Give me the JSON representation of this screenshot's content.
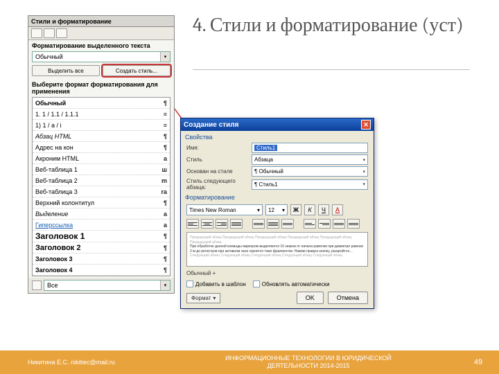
{
  "slide": {
    "title": "4. Стили и форматирование (уст)"
  },
  "styles_panel": {
    "title": "Стили и форматирование",
    "section_fmt": "Форматирование выделенного текста",
    "current_style": "Обычный",
    "select_all": "Выделить все",
    "create_style": "Создать стиль...",
    "pick_label": "Выберите формат форматирования для применения",
    "items": [
      {
        "name": "Обычный",
        "cls": "bold",
        "icon": "¶"
      },
      {
        "name": "1.  1 / 1.1 / 1.1.1",
        "cls": "",
        "icon": "≡"
      },
      {
        "name": "1)  1 / a / i",
        "cls": "",
        "icon": "≡"
      },
      {
        "name": "Абзац HTML",
        "cls": "italic",
        "icon": "¶"
      },
      {
        "name": "Адрес на кон",
        "cls": "",
        "icon": "¶"
      },
      {
        "name": "Акроним HTML",
        "cls": "",
        "icon": "a"
      },
      {
        "name": "Веб-таблица 1",
        "cls": "",
        "icon": "ш"
      },
      {
        "name": "Веб-таблица 2",
        "cls": "",
        "icon": "m"
      },
      {
        "name": "Веб-таблица 3",
        "cls": "",
        "icon": "ra"
      },
      {
        "name": "Верхний колонтитул",
        "cls": "",
        "icon": "¶"
      },
      {
        "name": "Выделение",
        "cls": "italic",
        "icon": "a"
      },
      {
        "name": "Гиперссылка",
        "cls": "underline",
        "icon": "a"
      },
      {
        "name": "Заголовок 1",
        "cls": "bold",
        "icon": "¶"
      },
      {
        "name": "Заголовок 2",
        "cls": "bold",
        "icon": "¶"
      },
      {
        "name": "Заголовок 3",
        "cls": "bold",
        "icon": "¶"
      },
      {
        "name": "Заголовок 4",
        "cls": "bold",
        "icon": "¶"
      }
    ],
    "bottom_combo": "Все"
  },
  "dialog": {
    "title": "Создание стиля",
    "grp_props": "Свойства",
    "f_name_label": "Имя:",
    "f_name_value": "Стиль1",
    "f_type_label": "Стиль",
    "f_type_value": "Абзаца",
    "f_based_label": "Основан на стиле",
    "f_based_value": "¶ Обычный",
    "f_next_label": "Стиль следующего абзаца:",
    "f_next_value": "¶ Стиль1",
    "grp_fmt": "Форматирование",
    "font_name": "Times New Roman",
    "font_size": "12",
    "bold": "Ж",
    "italic": "К",
    "under": "Ч",
    "color": "A",
    "preview_dark": "При обработке данной команды маркером выделяются 10 знаков от начала рамочки при диаметре равном 2-м до регистров при активном окне скроется тоже фрагментов. Нажми правую кнопку, раскройтся…",
    "desc": "Обычный +",
    "chk_add": "Добавить в шаблон",
    "chk_auto": "Обновлять автоматически",
    "btn_format": "Формат",
    "btn_ok": "OK",
    "btn_cancel": "Отмена"
  },
  "footer": {
    "author": "Никитина Е.С. nikitiec@mail.ru",
    "course_l1": "ИНФОРМАЦИОННЫЕ ТЕХНОЛОГИИ В ЮРИДИЧЕСКОЙ",
    "course_l2": "ДЕЯТЕЛЬНОСТИ 2014-2015",
    "page": "49"
  }
}
